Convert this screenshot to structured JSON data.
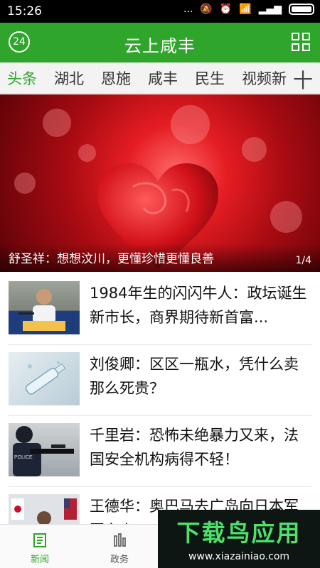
{
  "status": {
    "time": "15:26",
    "dots": "...",
    "signal": "atl"
  },
  "app": {
    "title": "云上咸丰",
    "badge": "24"
  },
  "tabs": [
    "头条",
    "湖北",
    "恩施",
    "咸丰",
    "民生",
    "视频新"
  ],
  "plus": "十",
  "hero": {
    "caption": "舒圣祥：想想汶川，更懂珍惜更懂良善",
    "pager": "1/4"
  },
  "news": [
    {
      "title": "1984年生的闪闪牛人：政坛诞生新市长，商界期待新首富..."
    },
    {
      "title": "刘俊卿：区区一瓶水，凭什么卖那么死贵？"
    },
    {
      "title": "千里岩：恐怖未绝暴力又来，法国安全机构病得不轻！"
    },
    {
      "title": "王德华：奥巴马去广岛向日本军国主义…"
    }
  ],
  "bottom": {
    "news_label": "新闻",
    "gov_label": "政务"
  },
  "watermark": {
    "main": "下载鸟应用",
    "url": "www.xiazainiao.com"
  },
  "colors": {
    "accent": "#2fa52b"
  }
}
